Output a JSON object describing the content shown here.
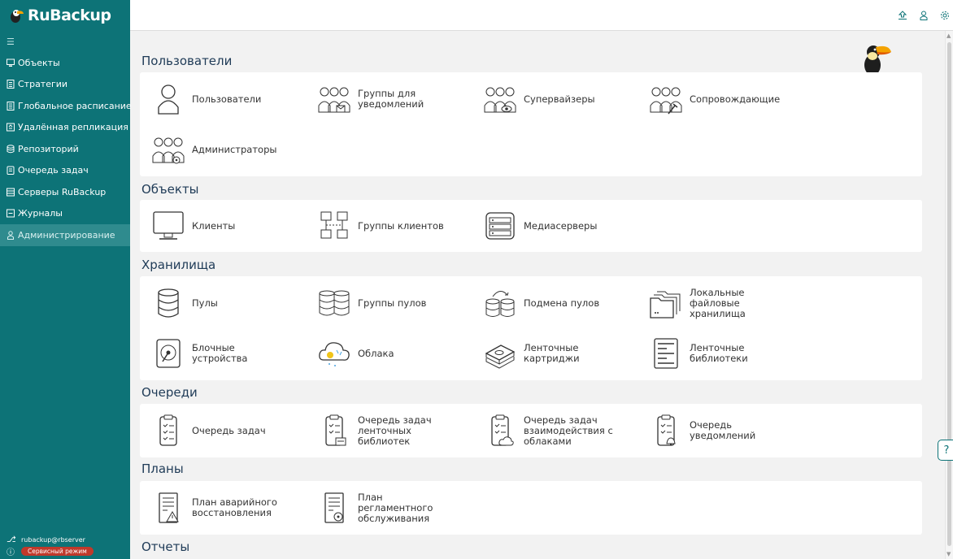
{
  "app": {
    "logo_text": "RuBackup"
  },
  "sidebar": {
    "items": [
      {
        "label": "Объекты",
        "icon": "monitor-icon"
      },
      {
        "label": "Стратегии",
        "icon": "document-icon"
      },
      {
        "label": "Глобальное расписание",
        "icon": "calendar-icon"
      },
      {
        "label": "Удалённая репликация",
        "icon": "replication-icon"
      },
      {
        "label": "Репозиторий",
        "icon": "database-icon"
      },
      {
        "label": "Очередь задач",
        "icon": "clipboard-icon"
      },
      {
        "label": "Серверы RuBackup",
        "icon": "server-icon"
      },
      {
        "label": "Журналы",
        "icon": "log-icon"
      },
      {
        "label": "Администрирование",
        "icon": "user-icon",
        "active": true
      }
    ],
    "footer": {
      "user": "rubackup@rbserver",
      "mode_badge": "Сервисный режим"
    }
  },
  "main": {
    "sections": [
      {
        "title": "Пользователи",
        "tiles": [
          {
            "label": "Пользователи",
            "icon": "user-icon"
          },
          {
            "label": "Группы для\nуведомлений",
            "icon": "group-notify-icon"
          },
          {
            "label": "Супервайзеры",
            "icon": "supervisor-icon"
          },
          {
            "label": "Сопровождающие",
            "icon": "maintainer-icon"
          },
          {
            "label": "Администраторы",
            "icon": "admin-group-icon"
          }
        ]
      },
      {
        "title": "Объекты",
        "tiles": [
          {
            "label": "Клиенты",
            "icon": "monitor-icon"
          },
          {
            "label": "Группы клиентов",
            "icon": "client-groups-icon"
          },
          {
            "label": "Медиасерверы",
            "icon": "media-server-icon"
          }
        ]
      },
      {
        "title": "Хранилища",
        "tiles": [
          {
            "label": "Пулы",
            "icon": "pool-icon"
          },
          {
            "label": "Группы пулов",
            "icon": "pool-groups-icon"
          },
          {
            "label": "Подмена пулов",
            "icon": "pool-swap-icon"
          },
          {
            "label": "Локальные\nфайловые\nхранилища",
            "icon": "folder-icon"
          },
          {
            "label": "Блочные\nустройства",
            "icon": "disk-icon"
          },
          {
            "label": "Облака",
            "icon": "cloud-icon"
          },
          {
            "label": "Ленточные\nкартриджи",
            "icon": "tape-cartridge-icon"
          },
          {
            "label": "Ленточные\nбиблиотеки",
            "icon": "tape-library-icon"
          }
        ]
      },
      {
        "title": "Очереди",
        "tiles": [
          {
            "label": "Очередь задач",
            "icon": "clipboard-icon"
          },
          {
            "label": "Очередь задач\nленточных\nбиблиотек",
            "icon": "clipboard-tape-icon"
          },
          {
            "label": "Очередь задач\nвзаимодействия с\nоблаками",
            "icon": "clipboard-cloud-icon"
          },
          {
            "label": "Очередь\nуведомлений",
            "icon": "clipboard-bell-icon"
          }
        ]
      },
      {
        "title": "Планы",
        "tiles": [
          {
            "label": "План аварийного\nвосстановления",
            "icon": "plan-warning-icon"
          },
          {
            "label": "План\nрегламентного\nобслуживания",
            "icon": "plan-maintenance-icon"
          }
        ]
      },
      {
        "title": "Отчеты",
        "tiles": []
      }
    ]
  },
  "colors": {
    "sidebar": "#0d7377",
    "active_item": "#2f8b8e",
    "title": "#1f3b57",
    "badge": "#c0392b"
  }
}
